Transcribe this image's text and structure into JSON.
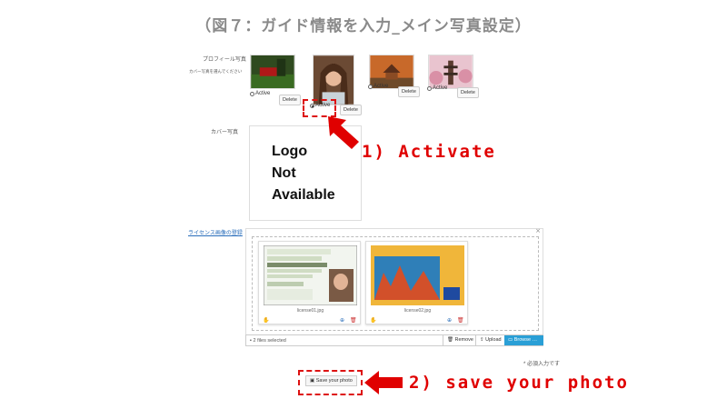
{
  "title": "（図７：ガイド情報を入力_メイン写真設定）",
  "profile": {
    "label": "プロフィール写真",
    "sublabel": "カバー写真を選んでください",
    "photos": [
      {
        "radio_label": "Active",
        "active": false,
        "delete_label": "Delete",
        "icon": "forest-photo"
      },
      {
        "radio_label": "Active",
        "active": true,
        "delete_label": "Delete",
        "icon": "portrait-photo"
      },
      {
        "radio_label": "Active",
        "active": false,
        "delete_label": "Delete",
        "icon": "autumn-temple-photo"
      },
      {
        "radio_label": "Active",
        "active": false,
        "delete_label": "Delete",
        "icon": "pagoda-photo"
      }
    ]
  },
  "cover": {
    "label": "カバー写真",
    "logo_lines": [
      "Logo",
      "Not",
      "Available"
    ]
  },
  "license": {
    "label": "ライセンス画像の登録",
    "files": [
      {
        "name": "license01.jpg",
        "icon": "drivers-license-image"
      },
      {
        "name": "license02.jpg",
        "icon": "diver-card-image"
      }
    ],
    "toolbar": {
      "selected_text": "2 files selected",
      "remove_label": "Remove",
      "upload_label": "Upload",
      "browse_label": "Browse …"
    }
  },
  "required_note": "* 必須入力です",
  "save_label": "Save your photo",
  "annotations": {
    "activate": "1) Activate",
    "save": "2) save your photo"
  },
  "colors": {
    "annotation_red": "#e00000",
    "browse_blue": "#2a9fd6",
    "title_gray": "#8a8a8a"
  }
}
